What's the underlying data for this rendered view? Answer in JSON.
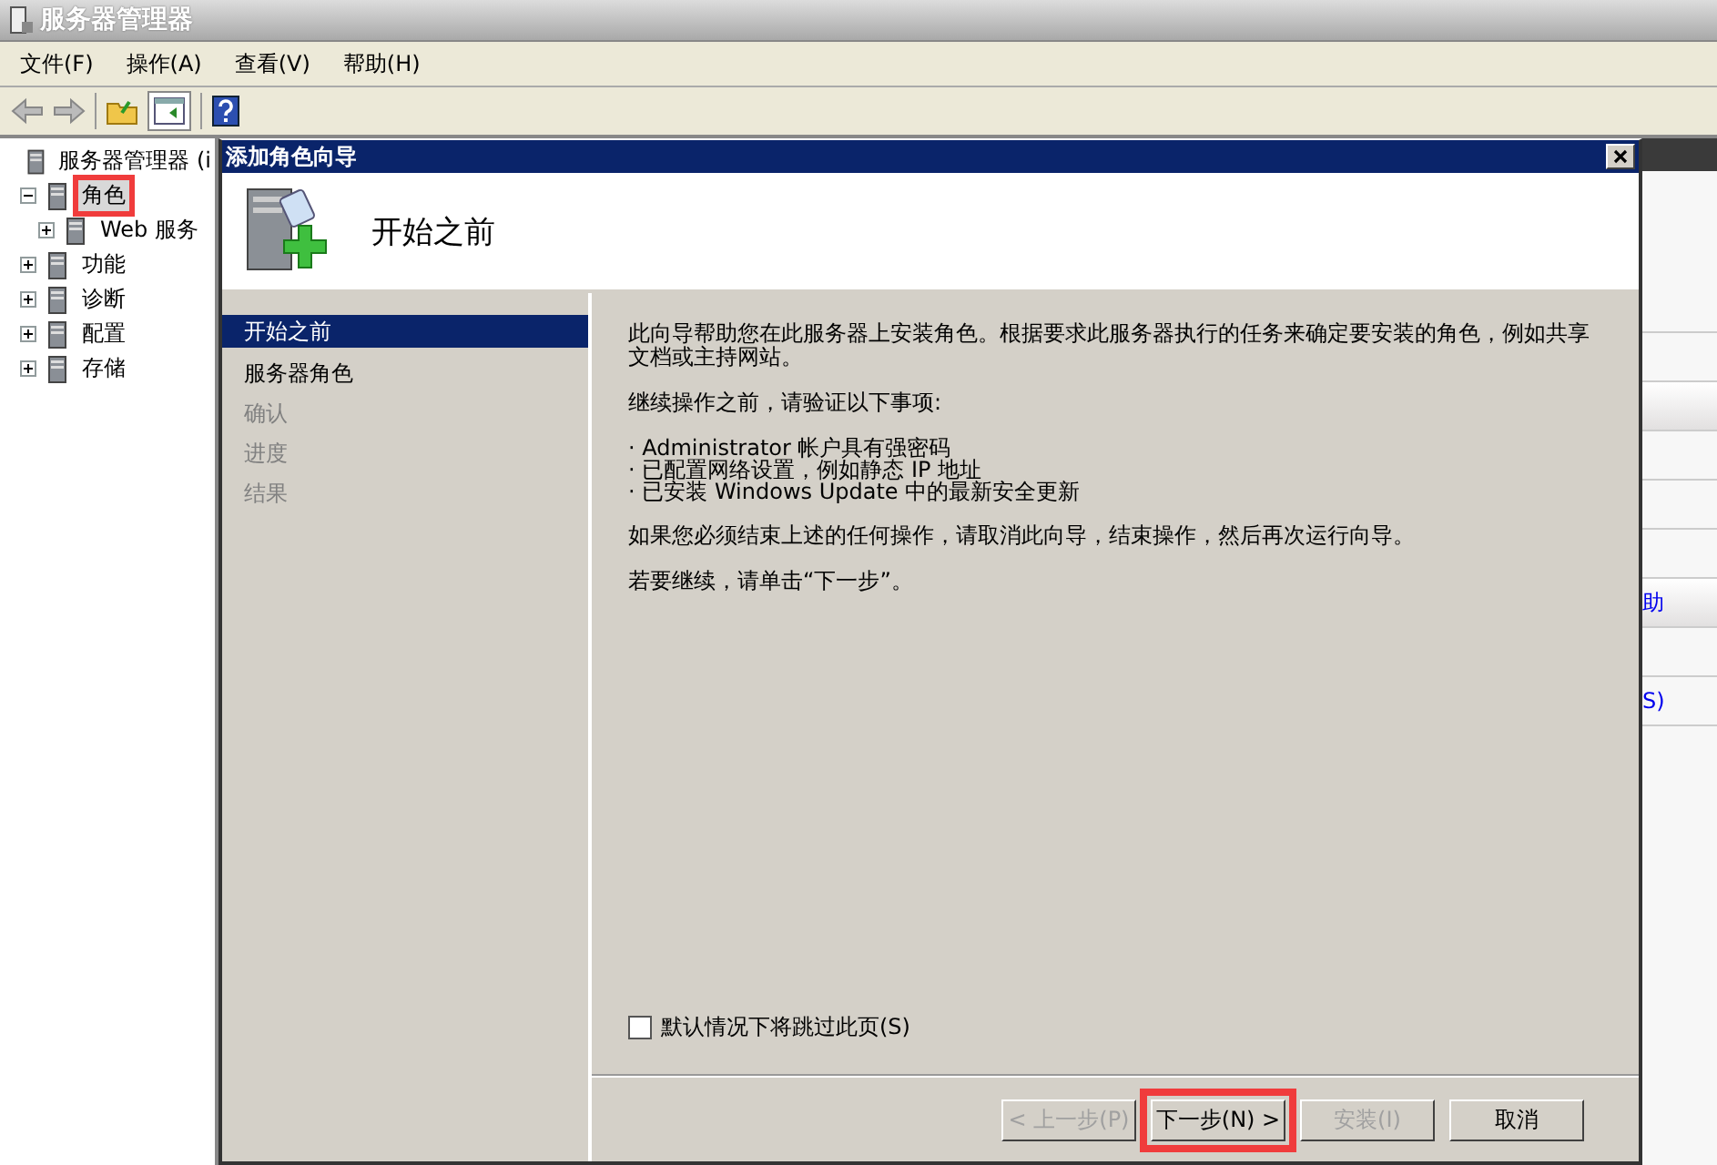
{
  "window": {
    "title": "服务器管理器"
  },
  "menu": [
    {
      "label": "文件(F)"
    },
    {
      "label": "操作(A)"
    },
    {
      "label": "查看(V)"
    },
    {
      "label": "帮助(H)"
    }
  ],
  "tree": [
    {
      "label": "服务器管理器 (i",
      "selected": false,
      "annotated": false,
      "children": [
        {
          "label": "角色",
          "selected": true,
          "annotated": true,
          "expanded": true,
          "children": [
            {
              "label": "Web 服务",
              "selected": false,
              "annotated": false,
              "expanded": false
            }
          ]
        },
        {
          "label": "功能",
          "selected": false,
          "annotated": false,
          "expanded": false
        },
        {
          "label": "诊断",
          "selected": false,
          "annotated": false,
          "expanded": false
        },
        {
          "label": "配置",
          "selected": false,
          "annotated": false,
          "expanded": false
        },
        {
          "label": "存储",
          "selected": false,
          "annotated": false,
          "expanded": false
        }
      ]
    }
  ],
  "right_panel": {
    "links": [
      "助",
      "S)"
    ]
  },
  "wizard": {
    "title": "添加角色向导",
    "page_title": "开始之前",
    "steps": [
      {
        "label": "开始之前",
        "selected": true,
        "disabled": false
      },
      {
        "label": "服务器角色",
        "selected": false,
        "disabled": false
      },
      {
        "label": "确认",
        "selected": false,
        "disabled": true
      },
      {
        "label": "进度",
        "selected": false,
        "disabled": true
      },
      {
        "label": "结果",
        "selected": false,
        "disabled": true
      }
    ],
    "intro": "此向导帮助您在此服务器上安装角色。根据要求此服务器执行的任务来确定要安装的角色，例如共享文档或主持网站。",
    "verify": "继续操作之前，请验证以下事项:",
    "bullets": [
      "· Administrator 帐户具有强密码",
      "· 已配置网络设置，例如静态 IP 地址",
      "· 已安装 Windows Update 中的最新安全更新"
    ],
    "cancel_note": "如果您必须结束上述的任何操作，请取消此向导，结束操作，然后再次运行向导。",
    "continue_note": "若要继续，请单击“下一步”。",
    "skip_checkbox": {
      "label": "默认情况下将跳过此页(S)",
      "checked": false
    },
    "buttons": [
      {
        "label": "< 上一步(P)",
        "disabled": true,
        "annotated": false
      },
      {
        "label": "下一步(N) >",
        "disabled": false,
        "annotated": true
      },
      {
        "label": "安装(I)",
        "disabled": true,
        "annotated": false
      },
      {
        "label": "取消",
        "disabled": false,
        "annotated": false
      }
    ]
  }
}
